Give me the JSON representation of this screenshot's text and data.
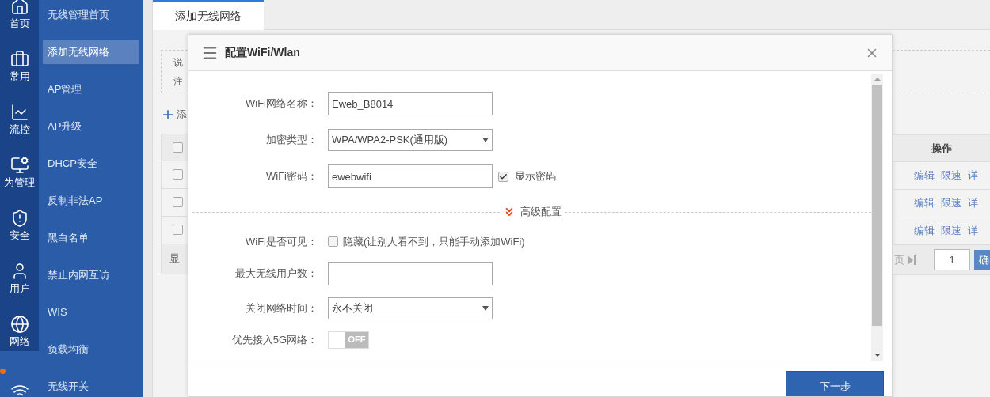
{
  "rail": {
    "items": [
      {
        "kind": "home",
        "label": "首页",
        "selected": false
      },
      {
        "kind": "briefcase",
        "label": "常用",
        "selected": false
      },
      {
        "kind": "chart",
        "label": "流控",
        "selected": false
      },
      {
        "kind": "monitor",
        "label": "为管理",
        "selected": false
      },
      {
        "kind": "shield",
        "label": "安全",
        "selected": false
      },
      {
        "kind": "user",
        "label": "用户",
        "selected": false
      },
      {
        "kind": "globe",
        "label": "网络",
        "selected": false
      },
      {
        "kind": "wifi",
        "selected": true
      }
    ]
  },
  "sidebar": {
    "items": [
      {
        "label": "无线管理首页",
        "selected": false
      },
      {
        "label": "添加无线网络",
        "selected": true
      },
      {
        "label": "AP管理",
        "selected": false
      },
      {
        "label": "AP升级",
        "selected": false
      },
      {
        "label": "DHCP安全",
        "selected": false
      },
      {
        "label": "反制非法AP",
        "selected": false
      },
      {
        "label": "黑白名单",
        "selected": false
      },
      {
        "label": "禁止内网互访",
        "selected": false
      },
      {
        "label": "WIS",
        "selected": false
      },
      {
        "label": "负载均衡",
        "selected": false
      },
      {
        "label": "无线开关",
        "selected": false
      }
    ]
  },
  "tab": {
    "label": "添加无线网络",
    "selected": true
  },
  "background": {
    "note_lines": [
      "说",
      "注"
    ],
    "add_link": "添",
    "header_checked": false,
    "action_header": "操作",
    "rows": [
      {
        "checked": false,
        "actions": [
          "编辑",
          "限速",
          "详"
        ]
      },
      {
        "checked": false,
        "actions": [
          "编辑",
          "限速",
          "详"
        ]
      },
      {
        "checked": false,
        "actions": [
          "编辑",
          "限速",
          "详"
        ]
      }
    ],
    "footer": {
      "left": "显",
      "pager": "页",
      "page_input": "1",
      "confirm": "确"
    }
  },
  "dialog": {
    "title": "配置WiFi/Wlan",
    "fields": [
      {
        "kind": "text",
        "label": "WiFi网络名称：",
        "value": "Eweb_B8014"
      },
      {
        "kind": "select",
        "label": "加密类型：",
        "value": "WPA/WPA2-PSK(通用版)"
      },
      {
        "kind": "password",
        "label": "WiFi密码：",
        "value": "ewebwifi",
        "option": {
          "label": "显示密码",
          "checked": true
        }
      }
    ],
    "advanced": {
      "label": "高级配置",
      "expanded": true
    },
    "advanced_fields": [
      {
        "kind": "checkbox",
        "label": "WiFi是否可见：",
        "text": "隐藏(让别人看不到，只能手动添加WiFi)",
        "checked": false
      },
      {
        "kind": "text",
        "label": "最大无线用户数："
      },
      {
        "kind": "select",
        "label": "关闭网络时间：",
        "value": "永不关闭"
      },
      {
        "kind": "toggle",
        "label": "优先接入5G网络：",
        "text": "OFF",
        "on": false
      }
    ],
    "next_button": "下一步"
  }
}
